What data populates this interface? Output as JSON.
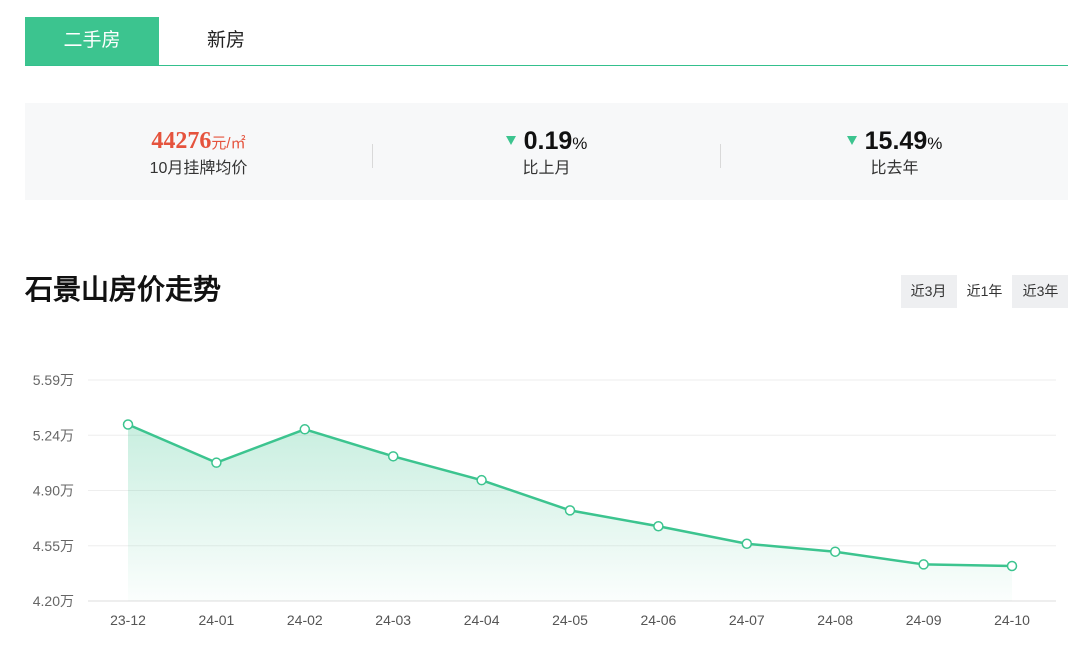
{
  "tabs": [
    {
      "label": "二手房",
      "active": true
    },
    {
      "label": "新房",
      "active": false
    }
  ],
  "stats": {
    "price": {
      "value": "44276",
      "unit": "元/㎡",
      "label": "10月挂牌均价"
    },
    "mom": {
      "value": "0.19",
      "unit": "%",
      "label": "比上月",
      "direction": "down"
    },
    "yoy": {
      "value": "15.49",
      "unit": "%",
      "label": "比去年",
      "direction": "down"
    }
  },
  "title": "石景山房价走势",
  "ranges": [
    {
      "label": "近3月",
      "active": false
    },
    {
      "label": "近1年",
      "active": true
    },
    {
      "label": "近3年",
      "active": false
    }
  ],
  "colors": {
    "accent": "#3cc48f",
    "price": "#e5533d",
    "line": "#3cc48f"
  },
  "chart_data": {
    "type": "area",
    "categories": [
      "23-12",
      "24-01",
      "24-02",
      "24-03",
      "24-04",
      "24-05",
      "24-06",
      "24-07",
      "24-08",
      "24-09",
      "24-10"
    ],
    "series": [
      {
        "values": [
          5.31,
          5.07,
          5.28,
          5.11,
          4.96,
          4.77,
          4.67,
          4.56,
          4.51,
          4.43,
          4.42
        ]
      }
    ],
    "yticks": [
      "5.59万",
      "5.24万",
      "4.90万",
      "4.55万",
      "4.20万"
    ],
    "ylim": [
      4.2,
      5.59
    ],
    "grid": true
  }
}
